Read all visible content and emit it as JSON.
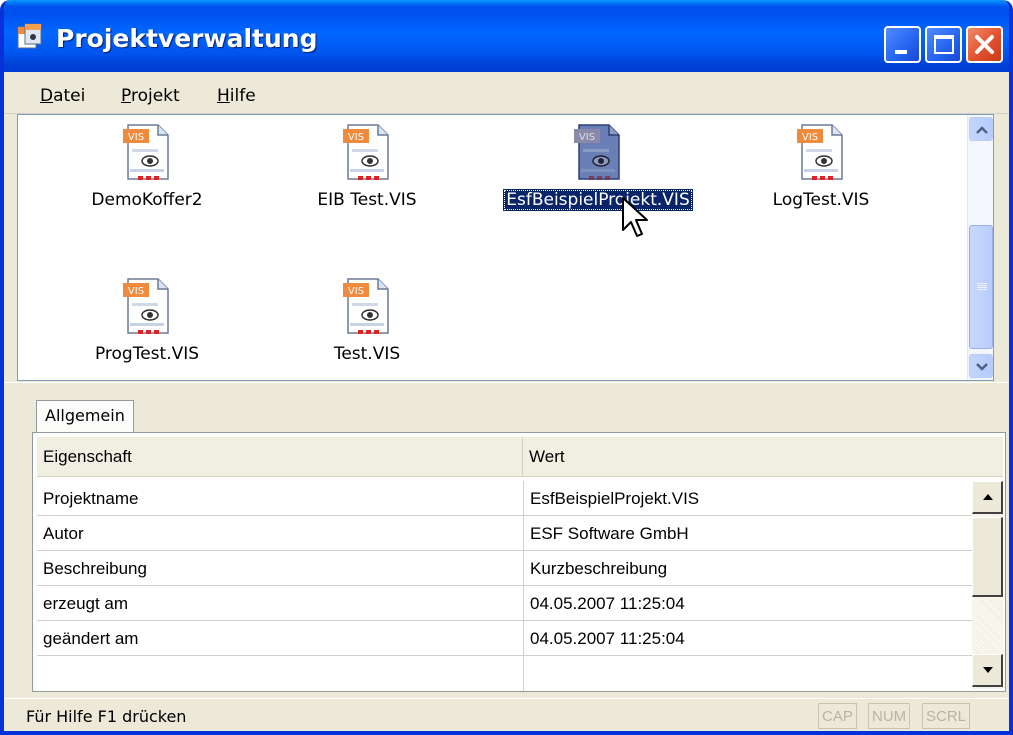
{
  "window": {
    "title": "Projektverwaltung",
    "title_icon": "vis-app-icon"
  },
  "titlebar_buttons": [
    "minimize-icon",
    "maximize-icon",
    "close-icon"
  ],
  "menu": {
    "items": [
      {
        "accel": "D",
        "rest": "atei"
      },
      {
        "accel": "P",
        "rest": "rojekt"
      },
      {
        "accel": "H",
        "rest": "ilfe"
      }
    ]
  },
  "files": [
    {
      "label": "DemoKoffer2",
      "icon_badge": "VIS",
      "selected": false
    },
    {
      "label": "EIB Test.VIS",
      "icon_badge": "VIS",
      "selected": false
    },
    {
      "label": "EsfBeispielProjekt.VIS",
      "icon_badge": "VIS",
      "selected": true
    },
    {
      "label": "LogTest.VIS",
      "icon_badge": "VIS",
      "selected": false
    },
    {
      "label": "ProgTest.VIS",
      "icon_badge": "VIS",
      "selected": false
    },
    {
      "label": "Test.VIS",
      "icon_badge": "VIS",
      "selected": false
    }
  ],
  "properties": {
    "tab_label": "Allgemein",
    "columns": [
      "Eigenschaft",
      "Wert"
    ],
    "rows": [
      [
        "Projektname",
        "EsfBeispielProjekt.VIS"
      ],
      [
        "Autor",
        "ESF Software GmbH"
      ],
      [
        "Beschreibung",
        "Kurzbeschreibung"
      ],
      [
        "erzeugt am",
        "04.05.2007 11:25:04"
      ],
      [
        "geändert am",
        "04.05.2007 11:25:04"
      ],
      [
        "",
        ""
      ]
    ]
  },
  "status": {
    "text": "Für Hilfe F1 drücken",
    "indicators": [
      "CAP",
      "NUM",
      "SCRL"
    ]
  },
  "colors": {
    "title_blue": "#0055ee",
    "selection": "#0a246a",
    "window_bg": "#ece9d8"
  }
}
